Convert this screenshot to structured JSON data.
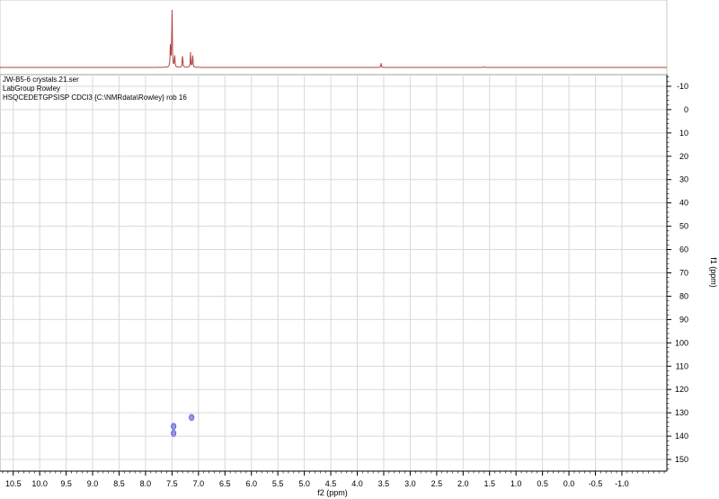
{
  "header": {
    "line1": "JW-B5-6 crystals.21.ser",
    "line2": "LabGroup Rowley",
    "line3": "HSQCEDETGPSISP CDCl3 {C:\\NMRdata\\Rowley} rob 16"
  },
  "chart_data": {
    "type": "scatter",
    "title": "",
    "xlabel": "f2 (ppm)",
    "ylabel": "f1 (ppm)",
    "xlim": [
      10.75,
      -1.85
    ],
    "ylim": [
      -15,
      155
    ],
    "x_ticks": [
      10.5,
      10.0,
      9.5,
      9.0,
      8.5,
      8.0,
      7.5,
      7.0,
      6.5,
      6.0,
      5.5,
      5.0,
      4.5,
      4.0,
      3.5,
      3.0,
      2.5,
      2.0,
      1.5,
      1.0,
      0.5,
      0.0,
      -0.5,
      -1.0
    ],
    "x_tick_labels": [
      "10.5",
      "10.0",
      "9.5",
      "9.0",
      "8.5",
      "8.0",
      "7.5",
      "7.0",
      "6.5",
      "6.0",
      "5.5",
      "5.0",
      "4.5",
      "4.0",
      "3.5",
      "3.0",
      "2.5",
      "2.0",
      "1.5",
      "1.0",
      "0.5",
      "0.0",
      "-0.5",
      "-1.0"
    ],
    "y_ticks": [
      -10,
      0,
      10,
      20,
      30,
      40,
      50,
      60,
      70,
      80,
      90,
      100,
      110,
      120,
      130,
      140,
      150
    ],
    "y_tick_labels": [
      "-10",
      "0",
      "10",
      "20",
      "30",
      "40",
      "50",
      "60",
      "70",
      "80",
      "90",
      "100",
      "110",
      "120",
      "130",
      "140",
      "150"
    ],
    "grid": true,
    "series": [
      {
        "type": "cross-peaks",
        "color": "#5a5ad6",
        "points": [
          {
            "x": 7.47,
            "y": 135.8
          },
          {
            "x": 7.47,
            "y": 138.8
          },
          {
            "x": 7.13,
            "y": 132.0
          }
        ]
      }
    ],
    "projection_1d": {
      "color": "#b04040",
      "peaks": [
        {
          "x": 7.5,
          "height": 1.0
        },
        {
          "x": 7.53,
          "height": 0.38
        },
        {
          "x": 7.45,
          "height": 0.22
        },
        {
          "x": 7.3,
          "height": 0.22
        },
        {
          "x": 7.15,
          "height": 0.24
        },
        {
          "x": 7.11,
          "height": 0.22
        },
        {
          "x": 3.55,
          "height": 0.07
        },
        {
          "x": 1.6,
          "height": 0.015
        }
      ]
    }
  }
}
